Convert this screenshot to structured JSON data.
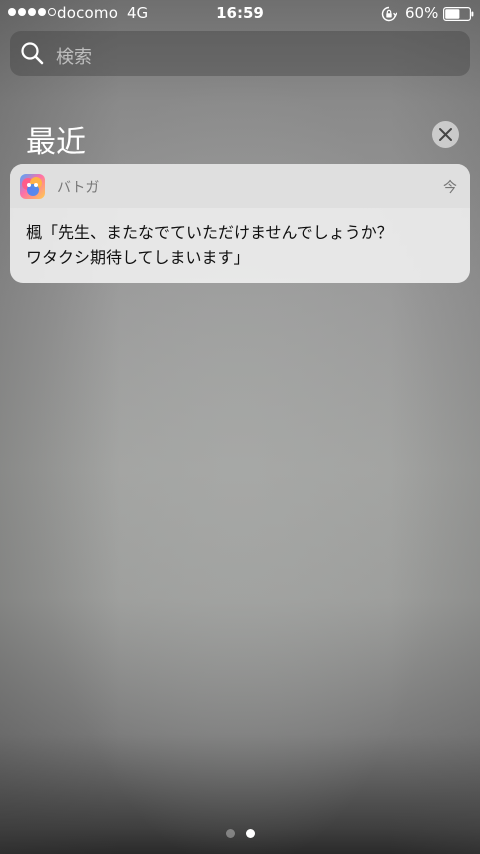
{
  "status_bar": {
    "signal_filled": 4,
    "signal_total": 5,
    "carrier": "docomo",
    "network": "4G",
    "time": "16:59",
    "battery_percent": "60%",
    "battery_level": 0.6
  },
  "search": {
    "placeholder": "検索",
    "icon": "search-icon"
  },
  "recent": {
    "title": "最近",
    "clear_icon": "close-icon"
  },
  "notification": {
    "app_name": "バトガ",
    "time": "今",
    "message_lines": [
      "楓「先生、またなでていただけませんでしょうか？",
      "ワタクシ期待してしまいます」"
    ]
  },
  "page_indicator": {
    "count": 2,
    "current": 2
  },
  "colors": {
    "card_background": "#f0f0f0",
    "card_header": "#dedede",
    "secondary_text": "#777777"
  }
}
